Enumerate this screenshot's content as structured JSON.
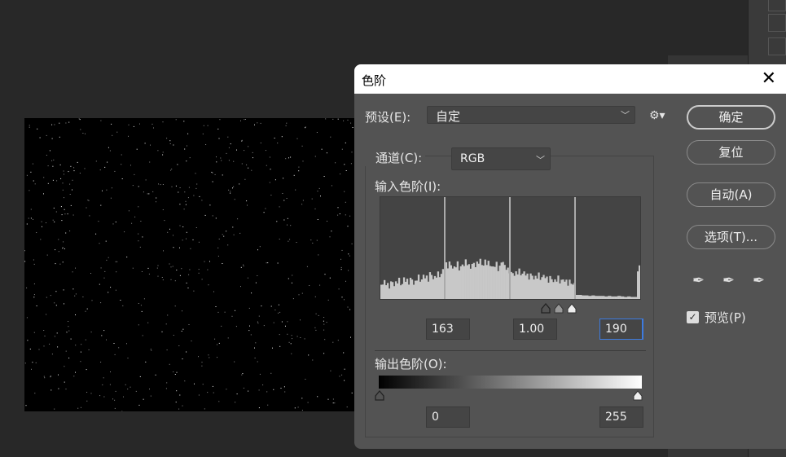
{
  "dialog": {
    "title": "色阶",
    "preset_label": "预设(E):",
    "preset_value": "自定",
    "channel_label": "通道(C):",
    "channel_value": "RGB",
    "input_label": "输入色阶(I):",
    "input_black": "163",
    "input_gamma": "1.00",
    "input_white": "190",
    "output_label": "输出色阶(O):",
    "output_black": "0",
    "output_white": "255",
    "buttons": {
      "ok": "确定",
      "reset": "复位",
      "auto": "自动(A)",
      "options": "选项(T)..."
    },
    "preview_label": "预览(P)",
    "preview_checked": true
  },
  "histogram": [
    0.14,
    0.16,
    0.13,
    0.17,
    0.15,
    0.18,
    0.14,
    0.19,
    0.17,
    0.2,
    0.16,
    0.21,
    0.18,
    0.22,
    0.2,
    0.25,
    0.21,
    0.24,
    0.23,
    0.28,
    0.33,
    0.35,
    0.31,
    0.34,
    0.3,
    0.33,
    0.36,
    0.32,
    0.35,
    0.34,
    0.37,
    0.33,
    0.36,
    0.35,
    0.32,
    0.34,
    0.3,
    0.36,
    0.31,
    0.28,
    0.26,
    0.25,
    0.27,
    0.24,
    0.25,
    0.22,
    0.24,
    0.21,
    0.23,
    0.2,
    0.22,
    0.19,
    0.21,
    0.18,
    0.2,
    0.17,
    0.18,
    0.16,
    0.17,
    0.15,
    0.04,
    0.04,
    0.035,
    0.035,
    0.03,
    0.035,
    0.03,
    0.03,
    0.03,
    0.025,
    0.03,
    0.025,
    0.025,
    0.03,
    0.025,
    0.02,
    0.025,
    0.02,
    0.02,
    0.3
  ]
}
